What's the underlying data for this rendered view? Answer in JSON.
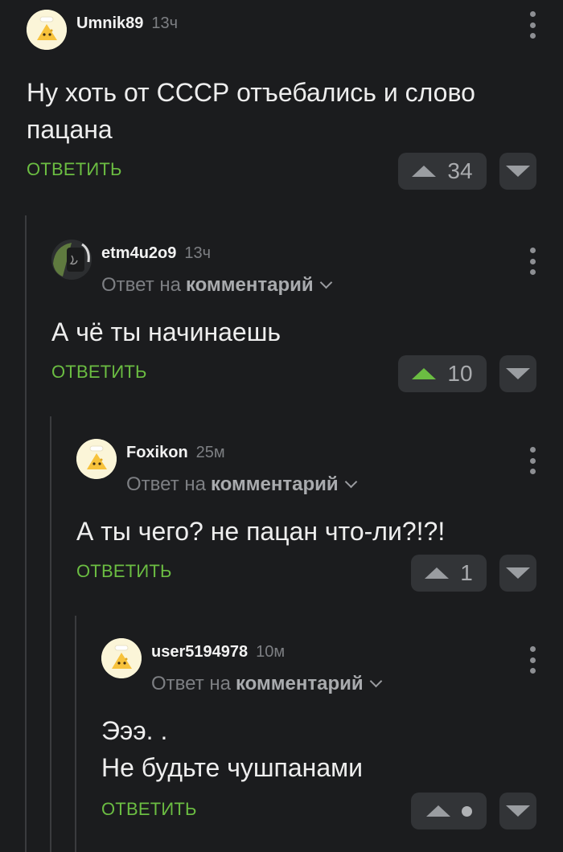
{
  "colors": {
    "background": "#1b1c1e",
    "accent_green": "#6bbd42",
    "vote_box": "#323437"
  },
  "comments": [
    {
      "username": "Umnik89",
      "time": "13ч",
      "avatar_icon": "default-cheese-avatar-icon",
      "text_lines": [
        "Ну хоть от СССР отъебались и слово",
        "пацана"
      ],
      "reply_label": "ОТВЕТИТЬ",
      "rating": "34",
      "upvoted": false
    },
    {
      "username": "etm4u2o9",
      "time": "13ч",
      "avatar_icon": "custom-photo-avatar-icon",
      "reply_to_prefix": "Ответ на",
      "reply_to_target": "комментарий",
      "text_lines": [
        "А чё ты начинаешь"
      ],
      "reply_label": "ОТВЕТИТЬ",
      "rating": "10",
      "upvoted": true
    },
    {
      "username": "Foxikon",
      "time": "25м",
      "avatar_icon": "default-cheese-avatar-icon",
      "reply_to_prefix": "Ответ на",
      "reply_to_target": "комментарий",
      "text_lines": [
        "А ты чего? не пацан что-ли?!?!"
      ],
      "reply_label": "ОТВЕТИТЬ",
      "rating": "1",
      "upvoted": false
    },
    {
      "username": "user5194978",
      "time": "10м",
      "avatar_icon": "default-cheese-avatar-icon",
      "reply_to_prefix": "Ответ на",
      "reply_to_target": "комментарий",
      "text_lines": [
        "Эээ. .",
        "Не будьте чушпанами"
      ],
      "reply_label": "ОТВЕТИТЬ",
      "rating": "",
      "rating_hidden_icon": "hidden-rating-dot-icon",
      "upvoted": false
    }
  ]
}
